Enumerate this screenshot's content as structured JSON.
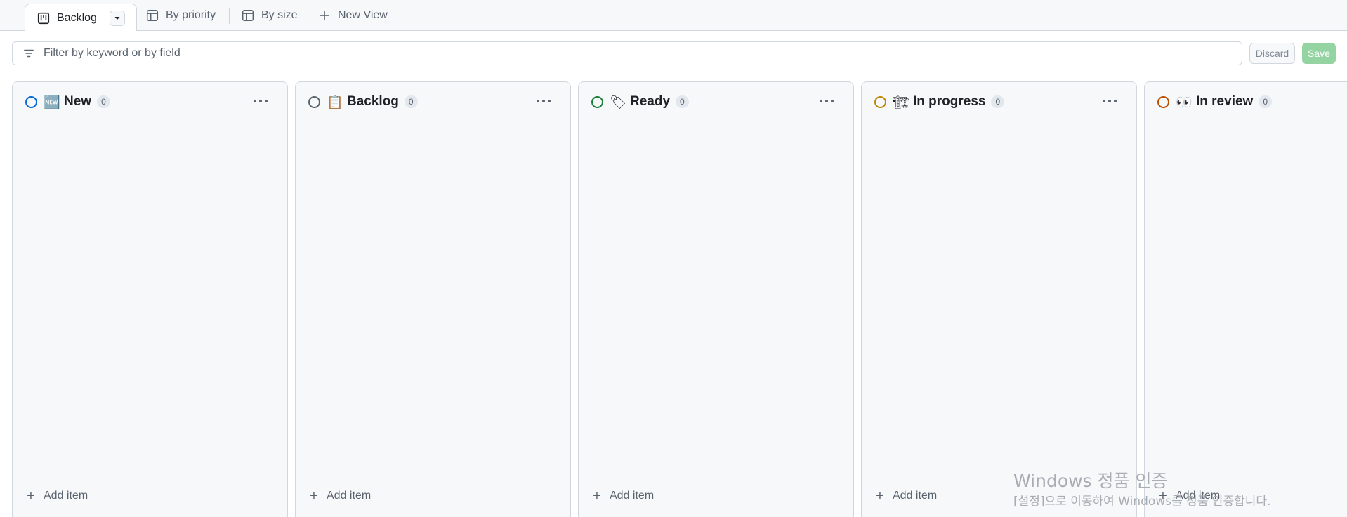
{
  "tabs": [
    {
      "label": "Backlog",
      "icon": "board-icon",
      "active": true
    },
    {
      "label": "By priority",
      "icon": "table-icon",
      "active": false
    },
    {
      "label": "By size",
      "icon": "table-icon",
      "active": false
    },
    {
      "label": "New View",
      "icon": "plus-icon",
      "active": false
    }
  ],
  "filter": {
    "placeholder": "Filter by keyword or by field",
    "discard_label": "Discard",
    "save_label": "Save"
  },
  "columns": [
    {
      "title": "New",
      "emoji": "🆕",
      "count": "0",
      "status_color": "#0969da",
      "add_label": "Add item"
    },
    {
      "title": "Backlog",
      "emoji": "📋",
      "count": "0",
      "status_color": "#59636e",
      "add_label": "Add item"
    },
    {
      "title": "Ready",
      "emoji": "🏷",
      "count": "0",
      "status_color": "#1a7f37",
      "add_label": "Add item"
    },
    {
      "title": "In progress",
      "emoji": "🏗",
      "count": "0",
      "status_color": "#bf8700",
      "add_label": "Add item"
    },
    {
      "title": "In review",
      "emoji": "👀",
      "count": "0",
      "status_color": "#bc4c00",
      "add_label": "Add item"
    }
  ],
  "watermark": {
    "line1": "Windows 정품 인증",
    "line2": "[설정]으로 이동하여 Windows를 정품 인증합니다."
  }
}
